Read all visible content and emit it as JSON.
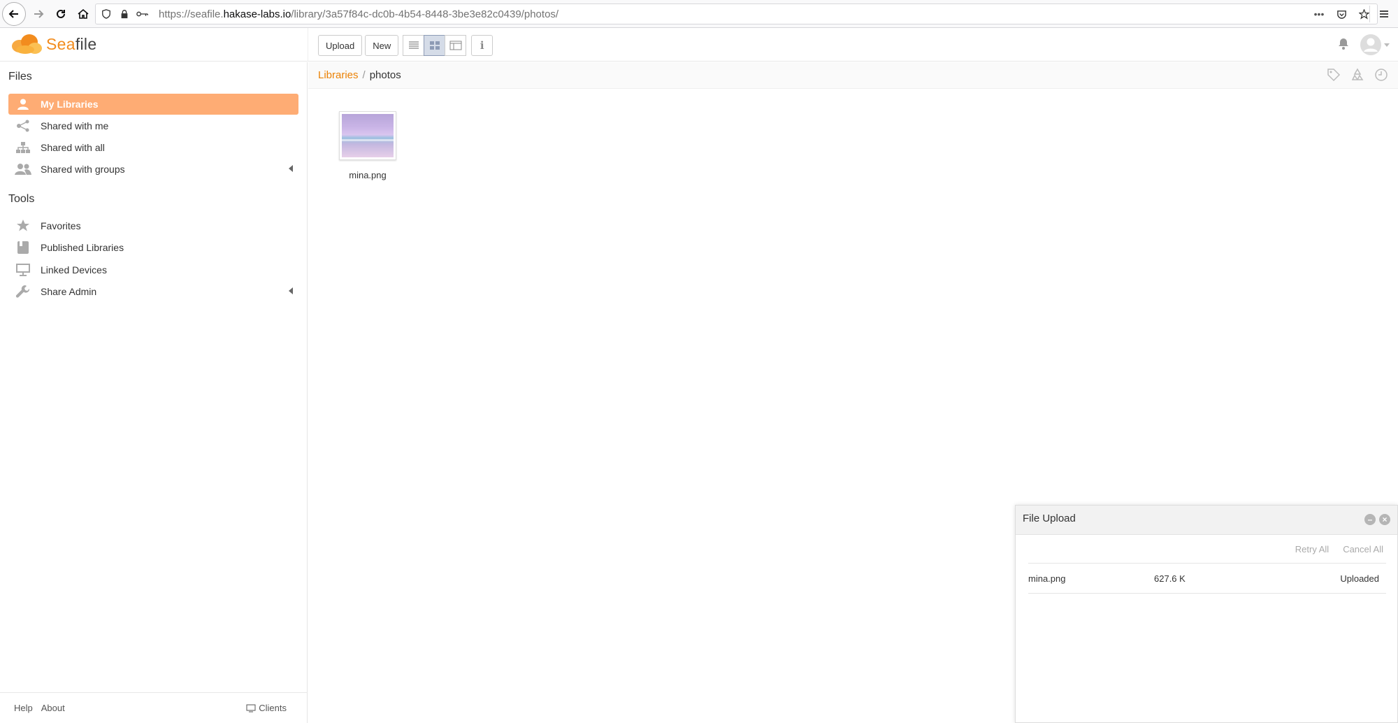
{
  "browser": {
    "url_prefix": "https://seafile.",
    "url_domain": "hakase-labs.io",
    "url_suffix": "/library/3a57f84c-dc0b-4b54-8448-3be3e82c0439/photos/",
    "more": "•••"
  },
  "header": {
    "logo_prefix": "Sea",
    "logo_suffix": "file",
    "upload_label": "Upload",
    "new_label": "New"
  },
  "sidebar": {
    "files_title": "Files",
    "tools_title": "Tools",
    "files_items": [
      {
        "label": "My Libraries",
        "icon": "person-icon"
      },
      {
        "label": "Shared with me",
        "icon": "share-icon"
      },
      {
        "label": "Shared with all",
        "icon": "org-icon"
      },
      {
        "label": "Shared with groups",
        "icon": "group-icon"
      }
    ],
    "tools_items": [
      {
        "label": "Favorites",
        "icon": "star-icon"
      },
      {
        "label": "Published Libraries",
        "icon": "book-icon"
      },
      {
        "label": "Linked Devices",
        "icon": "monitor-icon"
      },
      {
        "label": "Share Admin",
        "icon": "wrench-icon"
      }
    ],
    "footer": {
      "help": "Help",
      "about": "About",
      "clients": "Clients"
    }
  },
  "main": {
    "breadcrumb_root": "Libraries",
    "breadcrumb_sep": "/",
    "breadcrumb_current": "photos",
    "files": [
      {
        "name": "mina.png"
      }
    ]
  },
  "upload": {
    "title": "File Upload",
    "retry_all": "Retry All",
    "cancel_all": "Cancel All",
    "rows": [
      {
        "name": "mina.png",
        "size": "627.6 K",
        "status": "Uploaded"
      }
    ]
  },
  "colors": {
    "accent": "#eb8205",
    "active_nav": "#feac74"
  }
}
